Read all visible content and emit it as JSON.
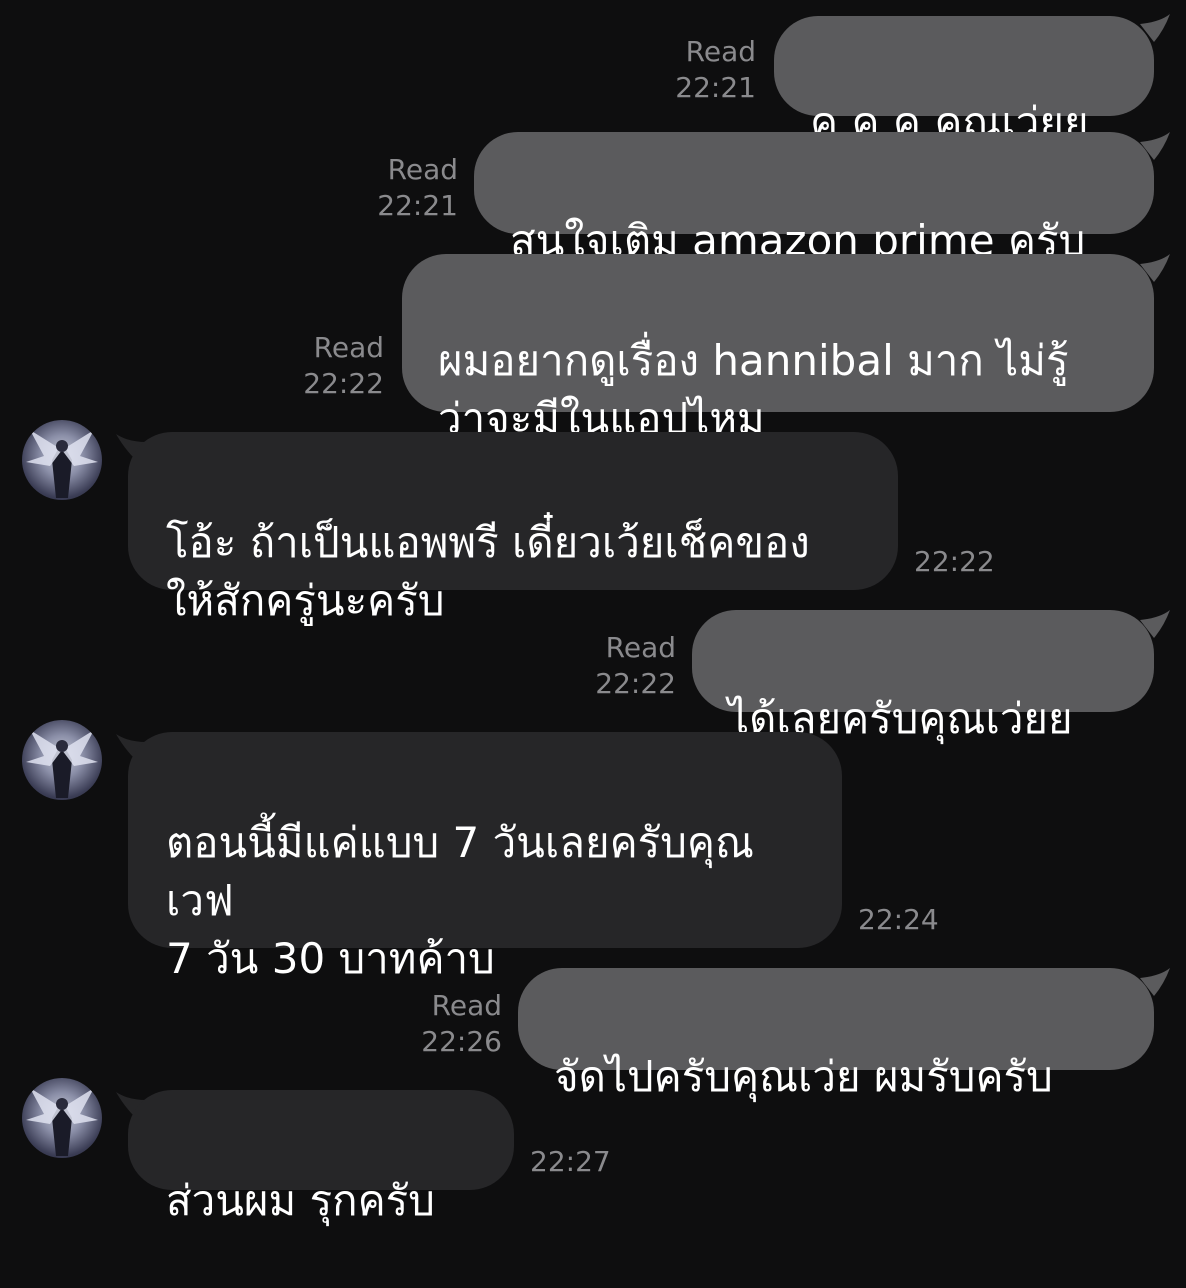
{
  "messages": [
    {
      "dir": "out",
      "text": "ค ค ค คุณเว่ยย",
      "read": "Read",
      "time": "22:21"
    },
    {
      "dir": "out",
      "text": "สนใจเติม amazon prime ครับ",
      "read": "Read",
      "time": "22:21"
    },
    {
      "dir": "out",
      "text": "ผมอยากดูเรื่อง hannibal มาก ไม่รู้\nว่าจะมีในแอปไหม",
      "read": "Read",
      "time": "22:22"
    },
    {
      "dir": "in",
      "text": "โอ้ะ ถ้าเป็นแอพพรี เดี๋ยวเว้ยเช็คของ\nให้สักครู่นะครับ",
      "time": "22:22"
    },
    {
      "dir": "out",
      "text": "ได้เลยครับคุณเว่ยย",
      "read": "Read",
      "time": "22:22"
    },
    {
      "dir": "in",
      "text": "ตอนนี้มีแค่แบบ 7 วันเลยครับคุณ\nเวฟ\n7 วัน 30 บาทค้าบ",
      "time": "22:24"
    },
    {
      "dir": "out",
      "text": "จัดไปครับคุณเว่ย ผมรับครับ",
      "read": "Read",
      "time": "22:26"
    },
    {
      "dir": "in",
      "text": "ส่วนผม รุกครับ",
      "time": "22:27"
    }
  ],
  "colors": {
    "background": "#0e0e0f",
    "outgoing_bubble": "#5b5b5d",
    "incoming_bubble": "#262628",
    "meta_text": "#8a8a8d",
    "message_text": "#ffffff"
  },
  "icons": {
    "avatar": "contact-avatar-icon"
  }
}
